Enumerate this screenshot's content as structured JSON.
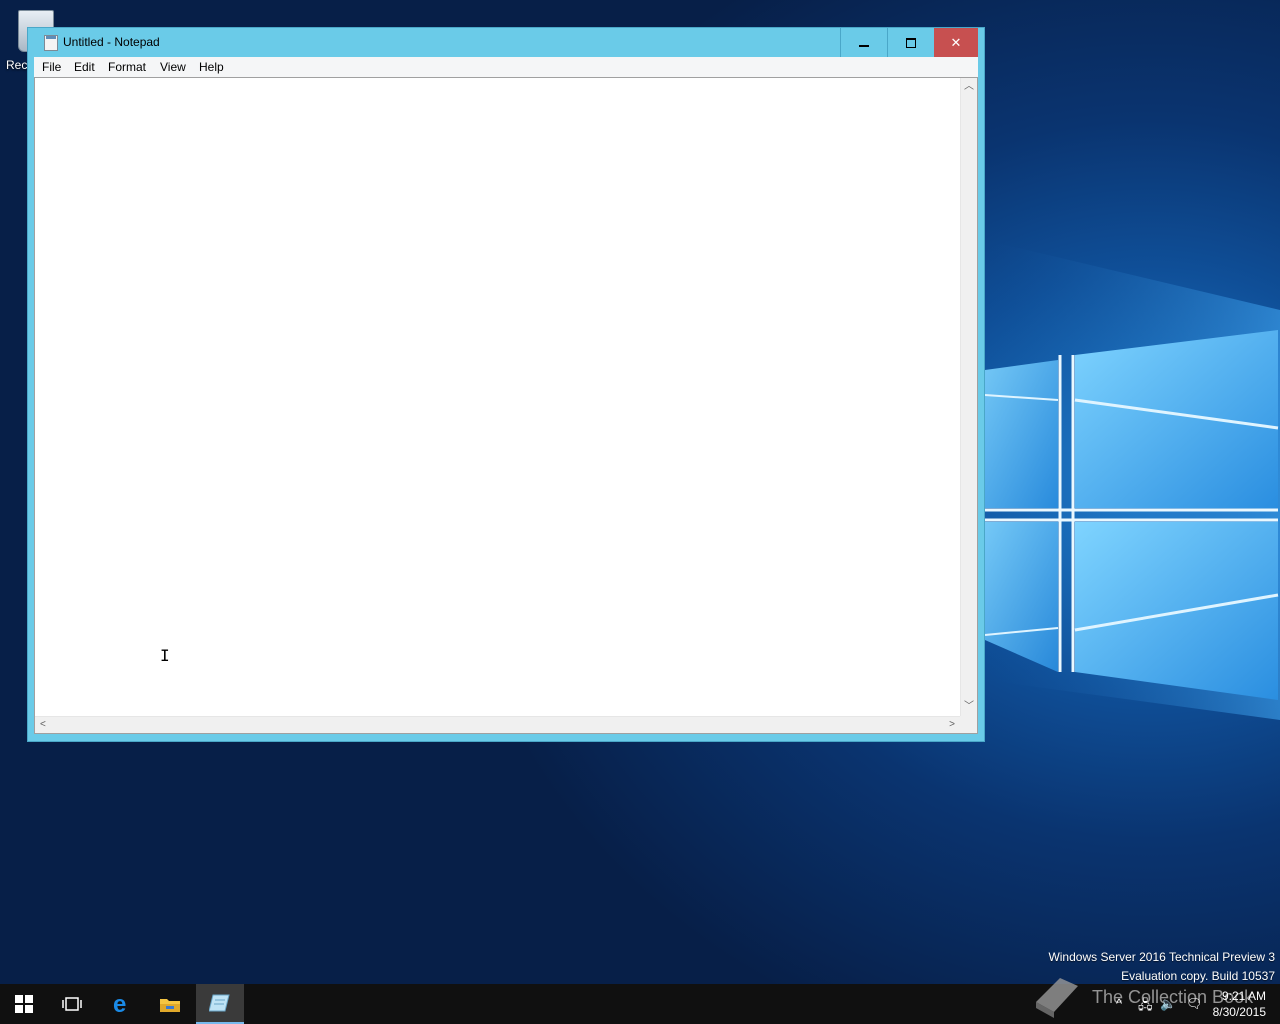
{
  "desktop": {
    "recycle_bin_label": "Rec",
    "watermark_line1": "Windows Server 2016 Technical Preview 3",
    "watermark_line2": "Evaluation copy. Build 10537"
  },
  "window": {
    "title": "Untitled - Notepad",
    "icon": "notepad-icon",
    "controls": {
      "minimize": "minimize-icon",
      "maximize": "maximize-icon",
      "close": "close-icon"
    },
    "close_label": "✕"
  },
  "menu": {
    "items": [
      {
        "label": "File"
      },
      {
        "label": "Edit"
      },
      {
        "label": "Format"
      },
      {
        "label": "View"
      },
      {
        "label": "Help"
      }
    ]
  },
  "editor": {
    "content": "",
    "cursor_glyph": "I"
  },
  "taskbar": {
    "apps": [
      "start-icon",
      "task-view-icon",
      "edge-icon",
      "file-explorer-icon",
      "notepad-icon"
    ],
    "watermark_text": "The Collection Book",
    "time": "9:21 AM",
    "date": "8/30/2015"
  },
  "colors": {
    "titlebar": "#6acbe8",
    "close_button": "#c75050",
    "taskbar": "#101010",
    "accent": "#76b9ed"
  }
}
